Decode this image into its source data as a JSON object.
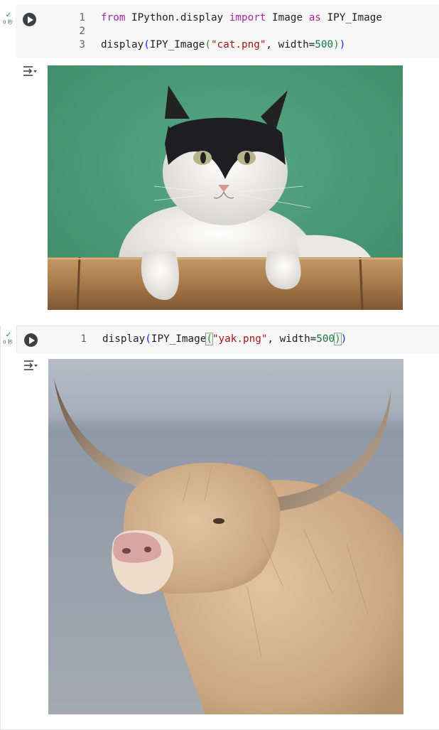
{
  "cells": [
    {
      "exec_check": "✓",
      "exec_time": "0 秒",
      "code_lines": [
        {
          "num": "1",
          "tokens": [
            {
              "t": "from",
              "c": "kw"
            },
            {
              "t": " IPython.display ",
              "c": "plain"
            },
            {
              "t": "import",
              "c": "kw"
            },
            {
              "t": " Image ",
              "c": "plain"
            },
            {
              "t": "as",
              "c": "kw"
            },
            {
              "t": " IPY_Image",
              "c": "plain"
            }
          ]
        },
        {
          "num": "2",
          "tokens": []
        },
        {
          "num": "3",
          "tokens": [
            {
              "t": "display",
              "c": "plain"
            },
            {
              "t": "(",
              "c": "p1"
            },
            {
              "t": "IPY_Image",
              "c": "plain"
            },
            {
              "t": "(",
              "c": "p2"
            },
            {
              "t": "\"cat.png\"",
              "c": "str"
            },
            {
              "t": ", width=",
              "c": "plain"
            },
            {
              "t": "500",
              "c": "num"
            },
            {
              "t": ")",
              "c": "p2"
            },
            {
              "t": ")",
              "c": "p1"
            }
          ]
        }
      ],
      "output_image": "cat-photo"
    },
    {
      "exec_check": "✓",
      "exec_time": "0 秒",
      "code_lines": [
        {
          "num": "1",
          "tokens": [
            {
              "t": "display",
              "c": "plain"
            },
            {
              "t": "(",
              "c": "p1"
            },
            {
              "t": "IPY_Image",
              "c": "plain"
            },
            {
              "t": "(",
              "c": "p2 br-hl"
            },
            {
              "t": "\"yak.png\"",
              "c": "str"
            },
            {
              "t": ", width=",
              "c": "plain"
            },
            {
              "t": "500",
              "c": "num"
            },
            {
              "t": ")",
              "c": "p2 br-hl"
            },
            {
              "t": ")",
              "c": "p1"
            }
          ]
        }
      ],
      "output_image": "yak-photo"
    }
  ],
  "icons": {
    "run": "play-icon",
    "output": "output-settings-icon"
  },
  "colors": {
    "cat_bg": "#4d9c79",
    "yak_bg": "#9ea7b1"
  }
}
